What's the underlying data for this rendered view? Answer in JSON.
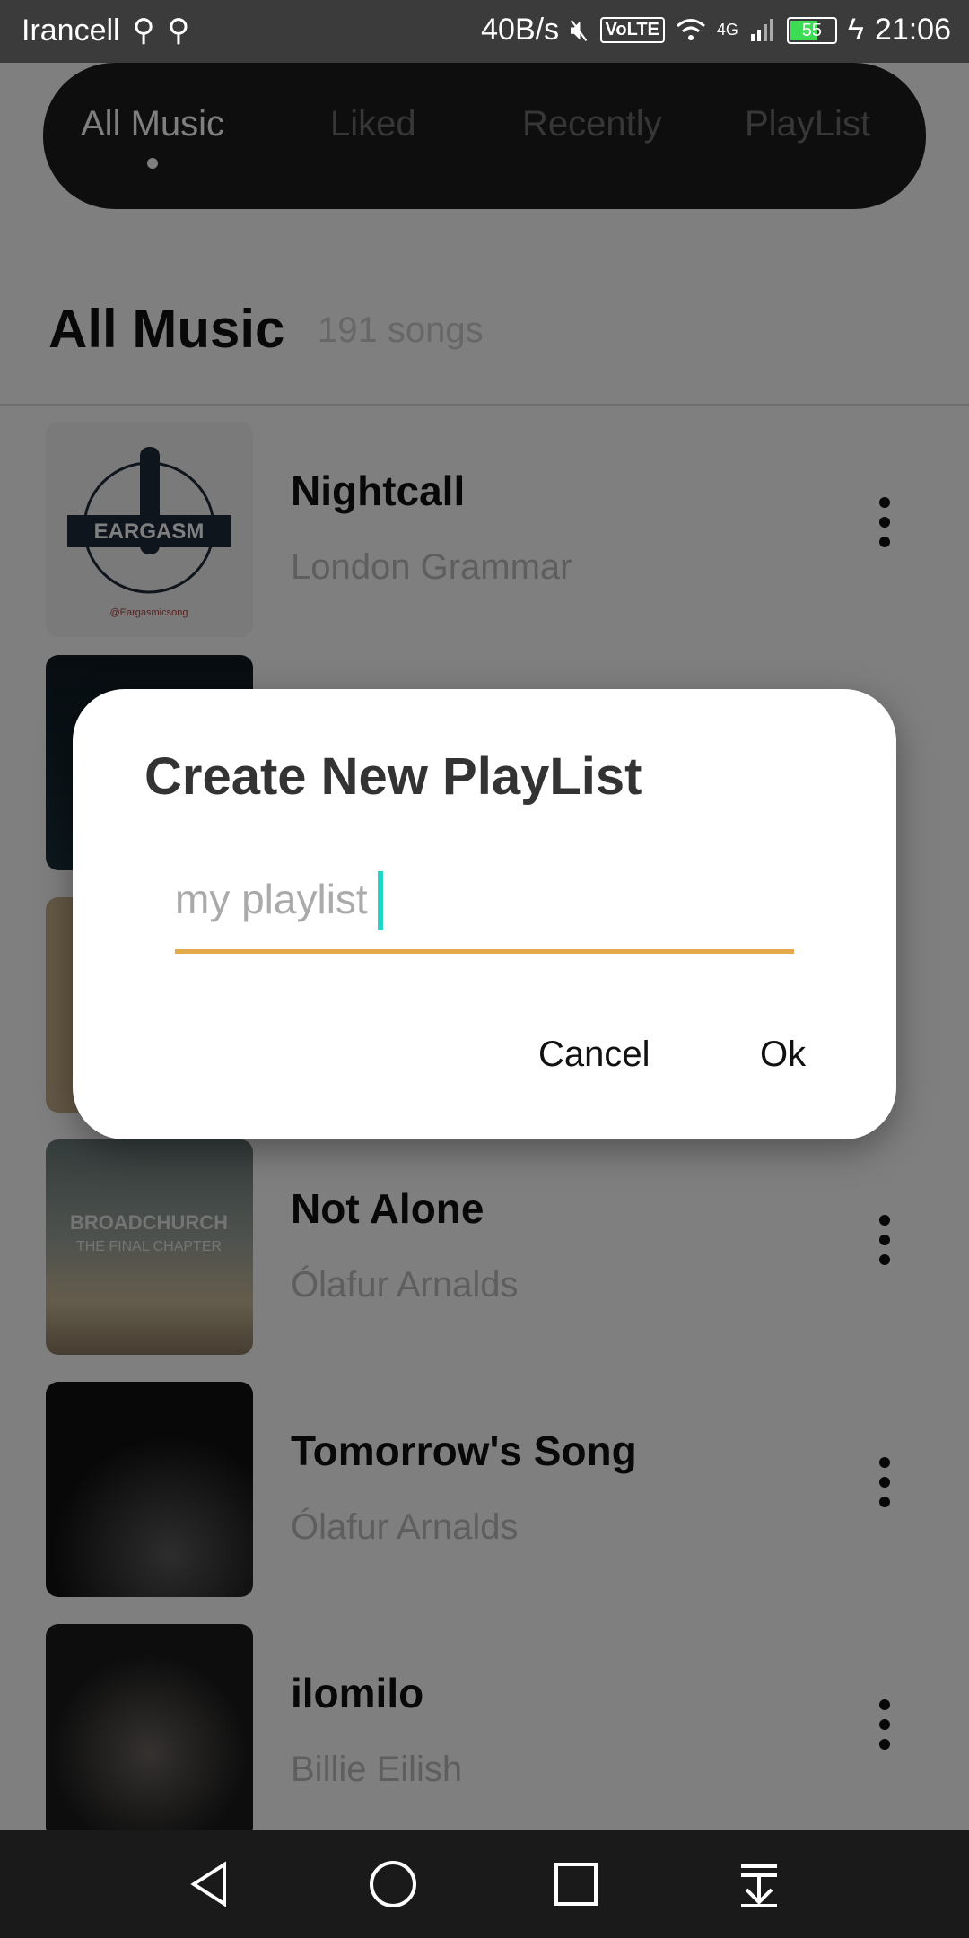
{
  "status": {
    "carrier": "Irancell",
    "speed": "40B/s",
    "volte": "VoLTE",
    "network": "4G",
    "battery": "55",
    "time": "21:06"
  },
  "tabs": [
    {
      "label": "All Music",
      "active": true
    },
    {
      "label": "Liked"
    },
    {
      "label": "Recently"
    },
    {
      "label": "PlayList"
    }
  ],
  "header": {
    "title": "All Music",
    "count": "191 songs"
  },
  "songs": [
    {
      "title": "Nightcall",
      "artist": "London Grammar",
      "art_text": "EARGASM",
      "art_sub": "@Eargasmicsong"
    },
    {
      "title": "",
      "artist": ""
    },
    {
      "title": "",
      "artist": ""
    },
    {
      "title": "Not Alone",
      "artist": "Ólafur Arnalds",
      "art_text": "BROADCHURCH",
      "art_sub": "THE FINAL CHAPTER"
    },
    {
      "title": "Tomorrow's Song",
      "artist": "Ólafur Arnalds"
    },
    {
      "title": "ilomilo",
      "artist": "Billie Eilish"
    }
  ],
  "dialog": {
    "title": "Create New PlayList",
    "input_value": "my playlist",
    "cancel": "Cancel",
    "ok": "Ok"
  },
  "colors": {
    "accent_line": "#e3a94b",
    "caret": "#1fd6c7"
  }
}
